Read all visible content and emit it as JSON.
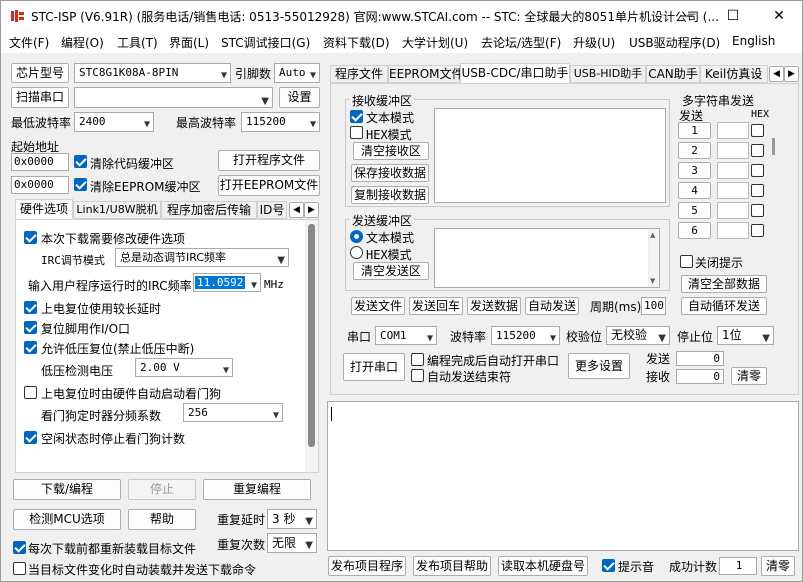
{
  "window": {
    "title": "STC-ISP (V6.91R) (服务电话/销售电话: 0513-55012928) 官网:www.STCAI.com  -- STC: 全球最大的8051单片机设计公司 (...",
    "minimize": "—",
    "maximize": "☐",
    "close": "✕"
  },
  "menu": [
    "文件(F)",
    "编程(O)",
    "工具(T)",
    "界面(L)",
    "STC调试接口(G)",
    "资料下载(D)",
    "大学计划(U)",
    "去论坛/选型(F)",
    "升级(U)",
    "USB驱动程序(D)",
    "English"
  ],
  "chip": {
    "label": "芯片型号",
    "value": "STC8G1K08A-8PIN",
    "pin_label": "引脚数",
    "pin_value": "Auto",
    "scan_button": "扫描串口",
    "port_value": "",
    "settings_button": "设置",
    "min_baud_label": "最低波特率",
    "min_baud": "2400",
    "max_baud_label": "最高波特率",
    "max_baud": "115200",
    "start_addr_label": "起始地址",
    "addr1": "0x0000",
    "clear_code_label": "清除代码缓冲区",
    "open_prog_button": "打开程序文件",
    "addr2": "0x0000",
    "clear_eeprom_label": "清除EEPROM缓冲区",
    "open_eeprom_button": "打开EEPROM文件"
  },
  "left_tabs": [
    "硬件选项",
    "Link1/U8W脱机",
    "程序加密后传输",
    "ID号"
  ],
  "hw": {
    "modify": "本次下载需要修改硬件选项",
    "irc_mode_label": "IRC调节模式",
    "irc_mode_value": "总是动态调节IRC频率",
    "irc_freq_label": "输入用户程序运行时的IRC频率",
    "irc_freq_value": "11.0592",
    "irc_freq_unit": "MHz",
    "power_delay": "上电复位使用较长延时",
    "reset_io": "复位脚用作I/O口",
    "low_volt_reset": "允许低压复位(禁止低压中断)",
    "low_volt_label": "低压检测电压",
    "low_volt_value": "2.00 V",
    "watchdog_auto": "上电复位时由硬件自动启动看门狗",
    "wdt_div_label": "看门狗定时器分频系数",
    "wdt_div_value": "256",
    "idle_stop_wdt": "空闲状态时停止看门狗计数"
  },
  "bottom_left": {
    "download": "下载/编程",
    "stop": "停止",
    "reprogram": "重复编程",
    "check_mcu": "检测MCU选项",
    "help": "帮助",
    "repeat_delay_label": "重复延时",
    "repeat_delay_value": "3 秒",
    "repeat_count_label": "重复次数",
    "repeat_count_value": "无限",
    "reload_before": "每次下载前都重新装载目标文件",
    "auto_on_change": "当目标文件变化时自动装载并发送下载命令"
  },
  "right_tabs": [
    "程序文件",
    "EEPROM文件",
    "USB-CDC/串口助手",
    "USB-HID助手",
    "CAN助手",
    "Keil仿真设"
  ],
  "serial": {
    "recv_group": "接收缓冲区",
    "recv_text_mode": "文本模式",
    "recv_hex_mode": "HEX模式",
    "clear_recv": "清空接收区",
    "save_recv": "保存接收数据",
    "copy_recv": "复制接收数据",
    "send_group": "发送缓冲区",
    "send_text_mode": "文本模式",
    "send_hex_mode": "HEX模式",
    "clear_send": "清空发送区",
    "send_file": "发送文件",
    "send_enter": "发送回车",
    "send_data": "发送数据",
    "auto_send": "自动发送",
    "period_label": "周期(ms)",
    "period_value": "100",
    "multi_title": "多字符串发送",
    "multi_send_header": "发送",
    "multi_hex_header": "HEX",
    "multi_rows": [
      "1",
      "2",
      "3",
      "4",
      "5",
      "6"
    ],
    "close_tip": "关闭提示",
    "clear_all": "清空全部数据",
    "auto_loop": "自动循环发送",
    "port_label": "串口",
    "port_value": "COM1",
    "baud_label": "波特率",
    "baud_value": "115200",
    "parity_label": "校验位",
    "parity_value": "无校验",
    "stop_label": "停止位",
    "stop_value": "1位",
    "open_port": "打开串口",
    "auto_open": "编程完成后自动打开串口",
    "auto_end": "自动发送结束符",
    "more_settings": "更多设置",
    "sent_label": "发送",
    "sent_value": "0",
    "recv_label": "接收",
    "recv_value": "0",
    "clear_count": "清零"
  },
  "bottom_right": {
    "publish_prog": "发布项目程序",
    "publish_help": "发布项目帮助",
    "read_disk": "读取本机硬盘号",
    "beep": "提示音",
    "success_label": "成功计数",
    "success_value": "1",
    "clear": "清零"
  }
}
